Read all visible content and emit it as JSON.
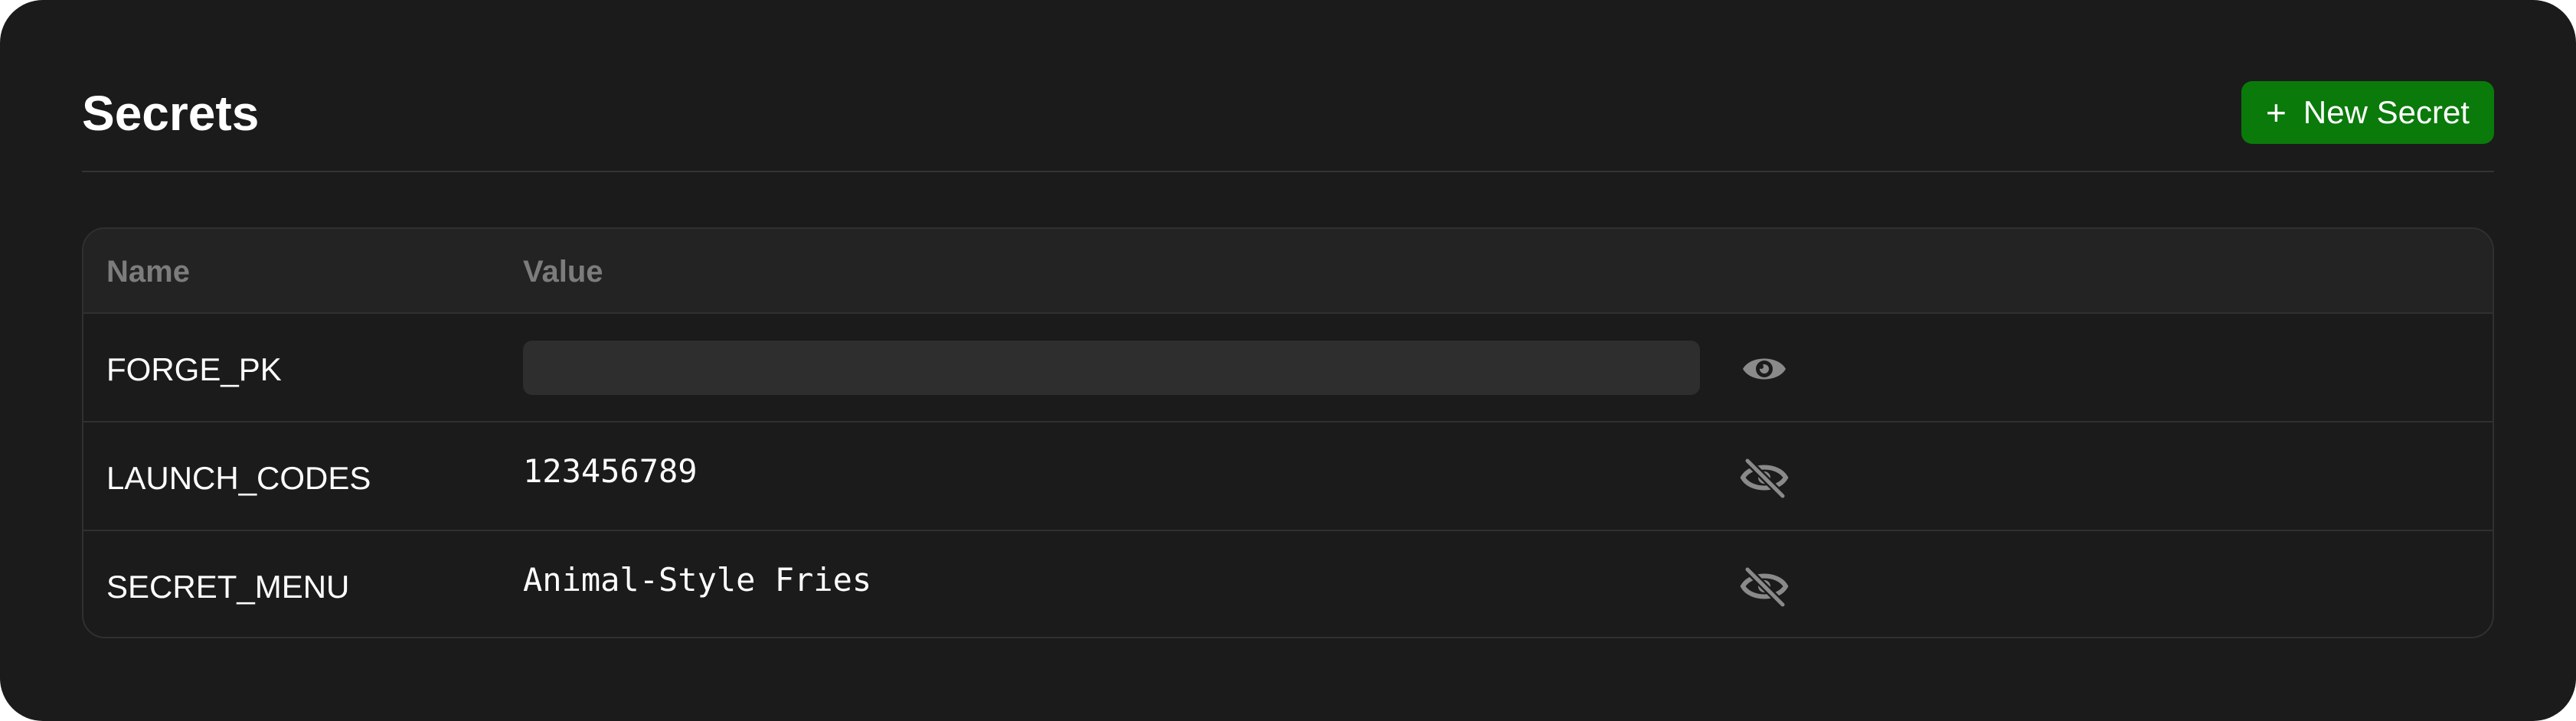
{
  "page": {
    "title": "Secrets"
  },
  "header": {
    "new_button_icon": "plus-icon",
    "new_button_label": "New Secret"
  },
  "table": {
    "columns": [
      "Name",
      "Value"
    ],
    "rows": [
      {
        "name": "FORGE_PK",
        "value": "",
        "revealed": false,
        "toggle_icon": "eye-icon"
      },
      {
        "name": "LAUNCH_CODES",
        "value": "123456789",
        "revealed": true,
        "toggle_icon": "eye-off-icon"
      },
      {
        "name": "SECRET_MENU",
        "value": "Animal-Style Fries",
        "revealed": true,
        "toggle_icon": "eye-off-icon"
      }
    ]
  },
  "colors": {
    "background": "#1b1b1b",
    "accent_button": "#0a7a0a",
    "header_text": "#7c7c7c",
    "icon": "#8a8a8a"
  }
}
